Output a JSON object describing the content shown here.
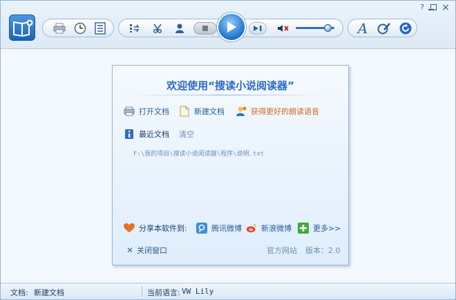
{
  "window": {
    "controls": {
      "help": "?",
      "minimize": "–",
      "maximize": "□",
      "close": "×"
    }
  },
  "toolbar": {
    "icons": [
      "app-logo-icon",
      "print-icon",
      "clock-icon",
      "list-icon",
      "import-icon",
      "scissors-icon",
      "user-icon",
      "stop-icon",
      "play-icon",
      "next-icon",
      "mute-icon",
      "font-icon",
      "paint-icon",
      "refresh-icon"
    ],
    "volume_level": 0.8
  },
  "panel": {
    "title": "欢迎使用“搜读小说阅读器”",
    "open_doc": "打开文档",
    "new_doc": "新建文档",
    "better_voice": "获得更好的朗读语音",
    "recent_docs": "最近文档",
    "clear": "清空",
    "recent_path": "F:\\我的项目\\搜读小说阅读器\\程序\\说明.txt",
    "share_label": "分享本软件到:",
    "tencent_weibo": "腾讯微博",
    "sina_weibo": "新浪微博",
    "more": "更多>>",
    "close_window": "关闭窗口",
    "official_site": "官方网站",
    "version": "版本：2.0"
  },
  "statusbar": {
    "doc_label": "文档:",
    "doc_value": "新建文档",
    "voice_label": "当前语言:",
    "voice_value": "VW Lily"
  },
  "colors": {
    "accent": "#2a6ac5",
    "orange_link": "#d4681a",
    "panel_bg": "#e4effb"
  }
}
